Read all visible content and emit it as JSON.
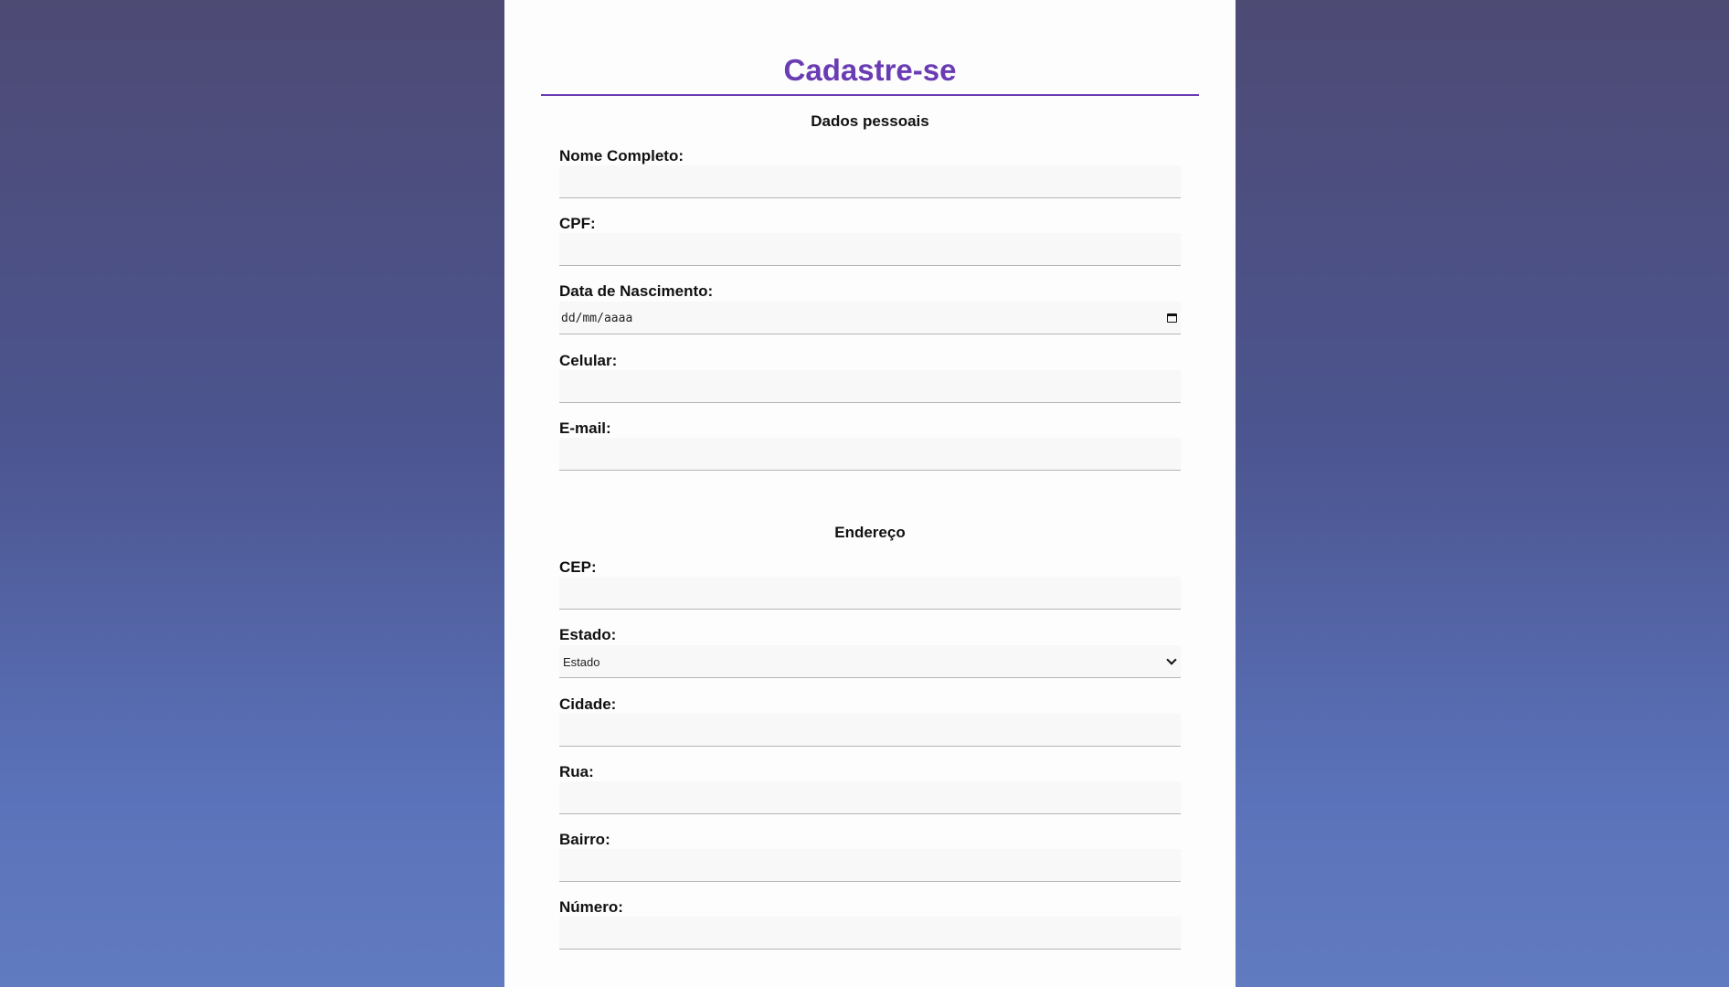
{
  "form": {
    "title": "Cadastre-se",
    "personal_section": {
      "title": "Dados pessoais",
      "fields": {
        "nome": {
          "label": "Nome Completo:",
          "value": ""
        },
        "cpf": {
          "label": "CPF:",
          "value": ""
        },
        "nascimento": {
          "label": "Data de Nascimento:",
          "placeholder": "dd/mm/aaaa",
          "icon": "calendar-icon"
        },
        "celular": {
          "label": "Celular:",
          "value": ""
        },
        "email": {
          "label": "E-mail:",
          "value": ""
        }
      }
    },
    "address_section": {
      "title": "Endereço",
      "fields": {
        "cep": {
          "label": "CEP:",
          "value": ""
        },
        "estado": {
          "label": "Estado:",
          "selected": "Estado",
          "icon": "chevron-down-icon"
        },
        "cidade": {
          "label": "Cidade:",
          "value": ""
        },
        "rua": {
          "label": "Rua:",
          "value": ""
        },
        "bairro": {
          "label": "Bairro:",
          "value": ""
        },
        "numero": {
          "label": "Número:",
          "value": ""
        }
      }
    }
  },
  "colors": {
    "accent": "#6a3cb4",
    "background_top": "#4d4a74",
    "background_bottom": "#617bc0"
  }
}
